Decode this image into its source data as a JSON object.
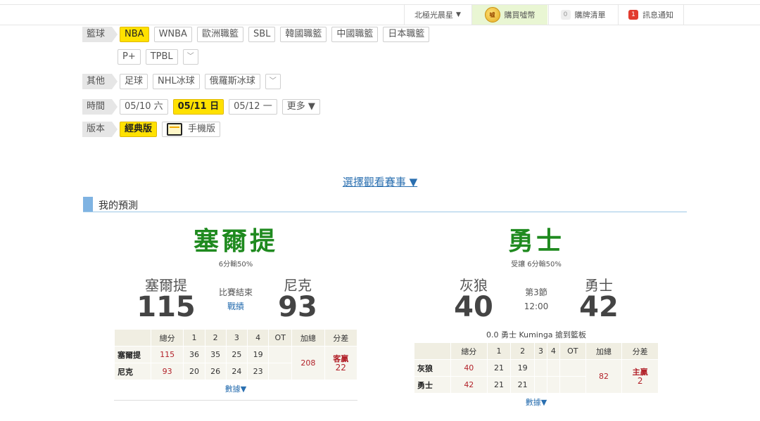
{
  "topbar": {
    "user": "北極光晨星",
    "buy_coin_label": "購買噓幣",
    "coin_glyph": "噓",
    "cart_count": "0",
    "cart_label": "購牌清單",
    "msg_count": "1",
    "msg_label": "訊息通知"
  },
  "filters": {
    "basketball_label": "籃球",
    "basketball": [
      "NBA",
      "WNBA",
      "歐洲職籃",
      "SBL",
      "韓國職籃",
      "中國職籃",
      "日本職籃"
    ],
    "basketball_row2": [
      "P+",
      "TPBL"
    ],
    "other_label": "其他",
    "other": [
      "足球",
      "NHL冰球",
      "俄羅斯冰球"
    ],
    "time_label": "時間",
    "dates": [
      "05/10 六",
      "05/11 日",
      "05/12 一"
    ],
    "more_label": "更多 ▼",
    "version_label": "版本",
    "classic_label": "經典版",
    "mobile_label": "手機版"
  },
  "select_games": "選擇觀看賽事 ▼",
  "section_title": "我的預測",
  "games": [
    {
      "pick": "塞爾提",
      "pick_note": "6分輸50%",
      "away_name": "塞爾提",
      "away_score": "115",
      "status": "比賽結束",
      "status_link": "戰績",
      "home_name": "尼克",
      "home_score": "93",
      "event": "",
      "headers": [
        "",
        "總分",
        "1",
        "2",
        "3",
        "4",
        "OT",
        "加總",
        "分差"
      ],
      "rows": [
        {
          "team": "塞爾提",
          "total": "115",
          "q": [
            "36",
            "35",
            "25",
            "19",
            ""
          ]
        },
        {
          "team": "尼克",
          "total": "93",
          "q": [
            "20",
            "26",
            "24",
            "23",
            ""
          ]
        }
      ],
      "sum": "208",
      "diff_label": "客贏",
      "diff_value": "22",
      "more": "數據▼"
    },
    {
      "pick": "勇士",
      "pick_note": "受讓 6分輸50%",
      "away_name": "灰狼",
      "away_score": "40",
      "status": "第3節",
      "status_link": "12:00",
      "home_name": "勇士",
      "home_score": "42",
      "event": "0.0 勇士 Kuminga 搶到籃板",
      "headers": [
        "",
        "總分",
        "1",
        "2",
        "3",
        "4",
        "OT",
        "加總",
        "分差"
      ],
      "rows": [
        {
          "team": "灰狼",
          "total": "40",
          "q": [
            "21",
            "19",
            "",
            "",
            ""
          ]
        },
        {
          "team": "勇士",
          "total": "42",
          "q": [
            "21",
            "21",
            "",
            "",
            ""
          ]
        }
      ],
      "sum": "82",
      "diff_label": "主贏",
      "diff_value": "2",
      "more": "數據▼"
    }
  ]
}
